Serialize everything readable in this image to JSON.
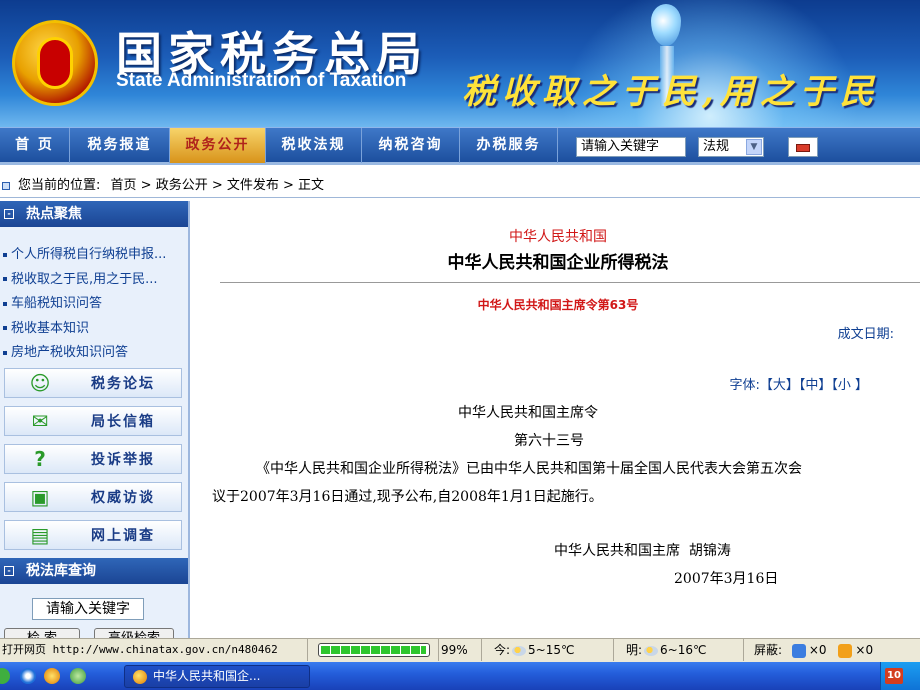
{
  "banner": {
    "title_cn": "国家税务总局",
    "title_en": "State Administration of Taxation",
    "slogan": "税收取之于民,用之于民"
  },
  "nav": {
    "items": [
      {
        "label": "首 页"
      },
      {
        "label": "税务报道"
      },
      {
        "label": "政务公开",
        "active": true
      },
      {
        "label": "税收法规"
      },
      {
        "label": "纳税咨询"
      },
      {
        "label": "办税服务"
      }
    ],
    "search_value": "请输入关键字",
    "select_value": "法规"
  },
  "breadcrumb": {
    "label": "您当前的位置:",
    "path": "首页 > 政务公开 > 文件发布 > 正文"
  },
  "sidebar": {
    "hot_title": "热点聚焦",
    "hot_items": [
      "个人所得税自行纳税申报...",
      "税收取之于民,用之于民...",
      "车船税知识问答",
      "税收基本知识",
      "房地产税收知识问答"
    ],
    "buttons": [
      {
        "label": "税务论坛",
        "icon": "person-icon"
      },
      {
        "label": "局长信箱",
        "icon": "mail-icon"
      },
      {
        "label": "投诉举报",
        "icon": "person-question-icon"
      },
      {
        "label": "权威访谈",
        "icon": "screen-icon"
      },
      {
        "label": "网上调查",
        "icon": "survey-icon"
      }
    ],
    "law_title": "税法库查询",
    "law_input": "请输入关键字",
    "btn_search": "检 索",
    "btn_advanced": "高级检索"
  },
  "document": {
    "country": "中华人民共和国",
    "title": "中华人民共和国企业所得税法",
    "order": "中华人民共和国主席令第63号",
    "date_label": "成文日期:",
    "font_label": "字体:",
    "font_large": "【大】",
    "font_medium": "【中】",
    "font_small": "【小 】",
    "line1": "中华人民共和国主席令",
    "line2": "第六十三号",
    "para1": "《中华人民共和国企业所得税法》已由中华人民共和国第十届全国人民代表大会第五次会",
    "para2": "议于2007年3月16日通过,现予公布,自2008年1月1日起施行。",
    "signature": "中华人民共和国主席  胡锦涛",
    "sign_date": "2007年3月16日"
  },
  "statusbar": {
    "url": "打开网页 http://www.chinatax.gov.cn/n480462",
    "progress": 0.99,
    "progress_text": "99%",
    "today": "今:",
    "today_temp": "5~15℃",
    "tomorrow": "明:",
    "tomorrow_temp": "6~16℃",
    "block_label": "屏蔽:",
    "block_count1": "×0",
    "block_count2": "×0"
  },
  "taskbar": {
    "task_label": "中华人民共和国企...",
    "tray_badge": "10"
  },
  "colors": {
    "nav_active": "#d8931a",
    "red_text": "#d11717",
    "link_blue": "#0f3f92"
  }
}
